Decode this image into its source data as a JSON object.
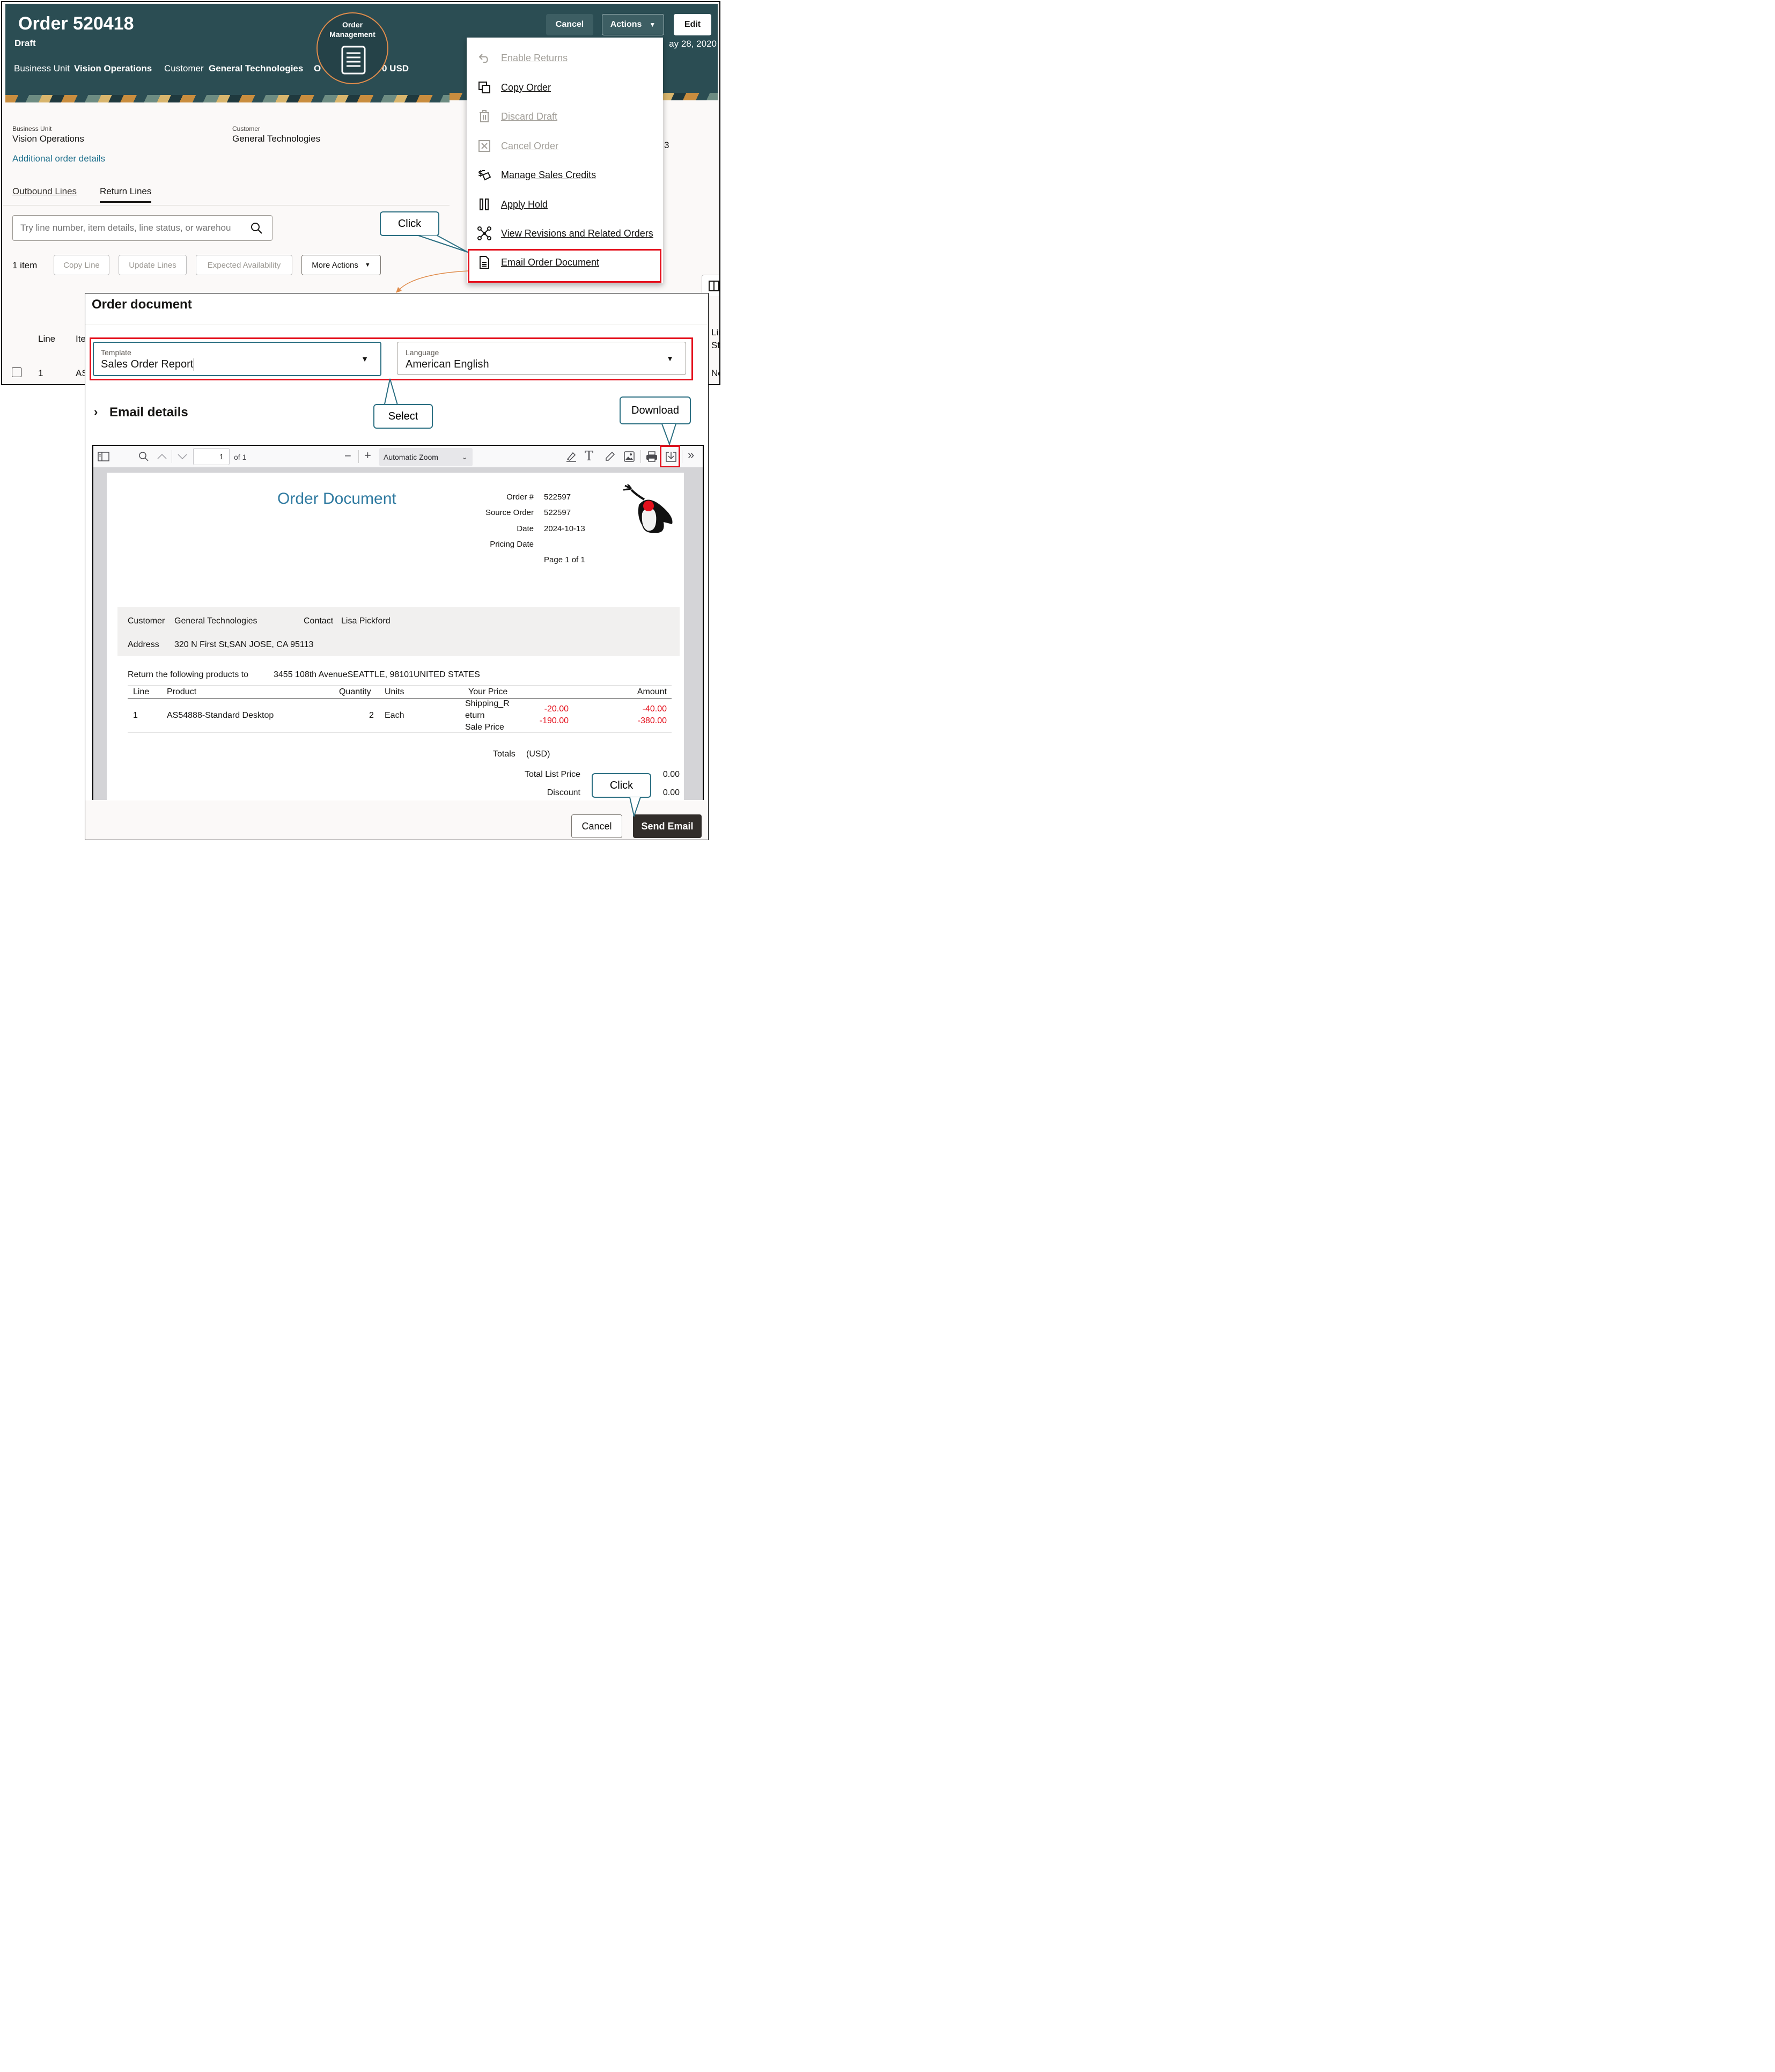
{
  "header": {
    "title": "Order 520418",
    "status": "Draft",
    "business_unit_label": "Business Unit",
    "business_unit_value": "Vision Operations",
    "customer_label": "Customer",
    "customer_value": "General Technologies",
    "order_total_fragment_left": "O",
    "order_total_fragment_right": "0 USD",
    "date_fragment": "ay 28, 2020",
    "badge_line1": "Order",
    "badge_line2": "Management"
  },
  "toolbar": {
    "cancel": "Cancel",
    "actions": "Actions",
    "edit": "Edit"
  },
  "actions_menu": [
    {
      "label": "Enable Returns",
      "icon": "undo-arrow-icon",
      "disabled": true
    },
    {
      "label": "Copy Order",
      "icon": "copy-icon",
      "disabled": false
    },
    {
      "label": "Discard Draft",
      "icon": "trash-icon",
      "disabled": true
    },
    {
      "label": "Cancel Order",
      "icon": "cancel-box-icon",
      "disabled": true
    },
    {
      "label": "Manage Sales Credits",
      "icon": "dollar-credit-icon",
      "disabled": false
    },
    {
      "label": "Apply Hold",
      "icon": "pause-icon",
      "disabled": false
    },
    {
      "label": "View Revisions and Related Orders",
      "icon": "network-icon",
      "disabled": false
    },
    {
      "label": "Email Order Document",
      "icon": "document-icon",
      "disabled": false
    }
  ],
  "summary": {
    "bu_label": "Business Unit",
    "bu_value": "Vision Operations",
    "cust_label": "Customer",
    "cust_value": "General Technologies",
    "link": "Additional order details",
    "right_fragment": "3"
  },
  "tabs": {
    "outbound": "Outbound Lines",
    "return": "Return Lines"
  },
  "search": {
    "placeholder": "Try line number, item details, line status, or warehou"
  },
  "lines_toolbar": {
    "count": "1 item",
    "copy_line": "Copy Line",
    "update_lines": "Update Lines",
    "expected_availability": "Expected Availability",
    "more_actions": "More Actions"
  },
  "table": {
    "col_line": "Line",
    "col_item": "Ite",
    "row_line": "1",
    "row_item": "AS",
    "right_col1": "Lin",
    "right_col2": "Sta",
    "right_row": "No"
  },
  "callouts": {
    "click1": "Click",
    "select": "Select",
    "download": "Download",
    "click2": "Click"
  },
  "dialog": {
    "title": "Order document",
    "template_label": "Template",
    "template_value": "Sales Order Report",
    "language_label": "Language",
    "language_value": "American English",
    "email_details": "Email details",
    "cancel": "Cancel",
    "send": "Send Email"
  },
  "pdf_viewer": {
    "page_number": "1",
    "page_of": "of 1",
    "zoom": "Automatic Zoom"
  },
  "document": {
    "heading": "Order Document",
    "meta": [
      {
        "label": "Order #",
        "value": "522597"
      },
      {
        "label": "Source Order",
        "value": "522597"
      },
      {
        "label": "Date",
        "value": "2024-10-13"
      },
      {
        "label": "Pricing Date",
        "value": ""
      }
    ],
    "page_info": "Page 1 of 1",
    "customer_label": "Customer",
    "customer_value": "General Technologies",
    "contact_label": "Contact",
    "contact_value": "Lisa Pickford",
    "address_label": "Address",
    "address_value": "320 N First St,SAN JOSE, CA 95113",
    "return_label": "Return the following products to",
    "return_value": "3455 108th AvenueSEATTLE, 98101UNITED STATES",
    "columns": [
      "Line",
      "Product",
      "Quantity",
      "Units",
      "Your Price",
      "Amount"
    ],
    "row": {
      "line": "1",
      "product": "AS54888-Standard Desktop",
      "quantity": "2",
      "units": "Each",
      "price_desc_1": "Shipping_R",
      "price_desc_2": "eturn",
      "price_desc_3": "Sale Price",
      "price_1": "-20.00",
      "price_2": "-190.00",
      "amount_1": "-40.00",
      "amount_2": "-380.00"
    },
    "totals_label": "Totals",
    "totals_currency": "(USD)",
    "total_list_price_label": "Total List Price",
    "total_list_price_value": "0.00",
    "discount_label": "Discount",
    "discount_value": "0.00"
  },
  "colors": {
    "header_bg": "#2b4d53",
    "highlight_red": "#e4101c",
    "callout_border": "#2b6f82",
    "link": "#1d6f8c",
    "badge_orange": "#e08c4b"
  }
}
